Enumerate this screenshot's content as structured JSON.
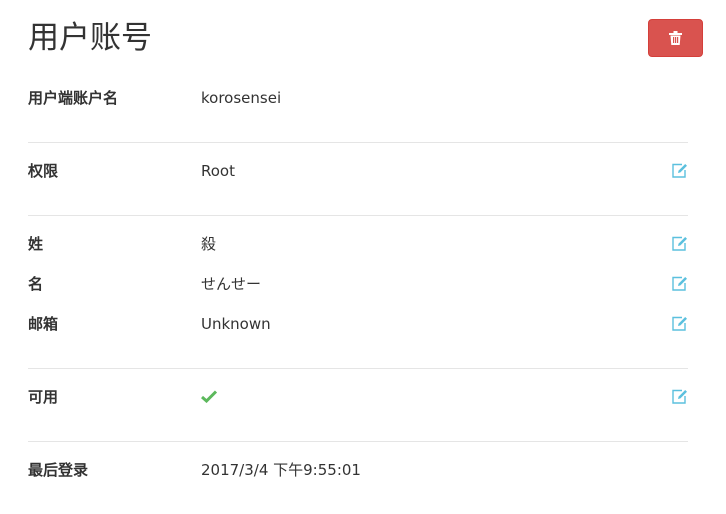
{
  "page": {
    "title": "用户账号"
  },
  "toolbar": {
    "delete_icon": "trash-icon",
    "accent": "#d9534f"
  },
  "fields": {
    "username": {
      "label": "用户端账户名",
      "value": "korosensei"
    },
    "permission": {
      "label": "权限",
      "value": "Root"
    },
    "last_name": {
      "label": "姓",
      "value": "殺"
    },
    "first_name": {
      "label": "名",
      "value": "せんせー"
    },
    "email": {
      "label": "邮箱",
      "value": "Unknown"
    },
    "enabled": {
      "label": "可用",
      "value": "true",
      "icon": "check-icon",
      "color": "#5cb85c"
    },
    "last_login": {
      "label": "最后登录",
      "value": "2017/3/4 下午9:55:01"
    }
  },
  "edit_icon": {
    "name": "edit-icon",
    "color": "#5bc0de"
  }
}
